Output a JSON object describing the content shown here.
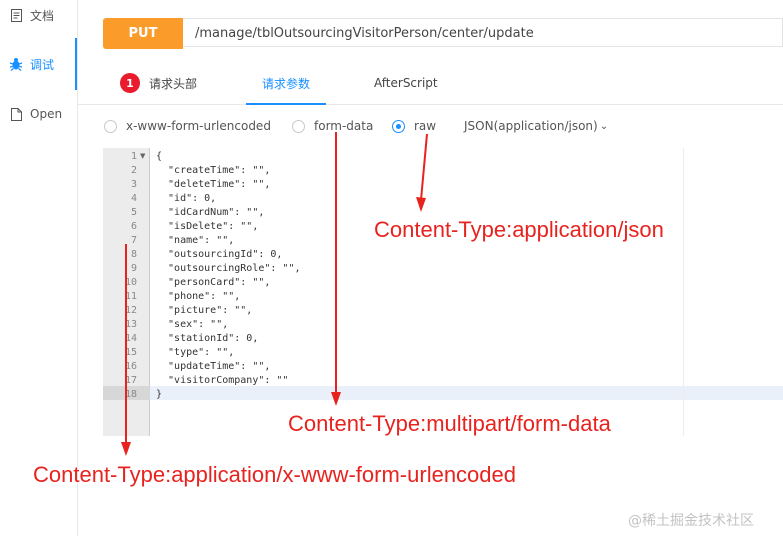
{
  "sidebar": {
    "items": [
      {
        "label": "文档",
        "icon": "document-icon"
      },
      {
        "label": "调试",
        "icon": "bug-icon"
      },
      {
        "label": "Open",
        "icon": "file-icon"
      }
    ]
  },
  "request": {
    "method": "PUT",
    "url": "/manage/tblOutsourcingVisitorPerson/center/update"
  },
  "tabs": [
    {
      "label": "请求头部",
      "badge": "1"
    },
    {
      "label": "请求参数"
    },
    {
      "label": "AfterScript"
    }
  ],
  "body_types": {
    "options": [
      "x-www-form-urlencoded",
      "form-data",
      "raw"
    ],
    "selected": "raw",
    "raw_format": "JSON(application/json)"
  },
  "editor": {
    "line_numbers": [
      "1",
      "2",
      "3",
      "4",
      "5",
      "6",
      "7",
      "8",
      "9",
      "10",
      "11",
      "12",
      "13",
      "14",
      "15",
      "16",
      "17",
      "18"
    ],
    "lines": [
      "{",
      "  \"createTime\": \"\",",
      "  \"deleteTime\": \"\",",
      "  \"id\": 0,",
      "  \"idCardNum\": \"\",",
      "  \"isDelete\": \"\",",
      "  \"name\": \"\",",
      "  \"outsourcingId\": 0,",
      "  \"outsourcingRole\": \"\",",
      "  \"personCard\": \"\",",
      "  \"phone\": \"\",",
      "  \"picture\": \"\",",
      "  \"sex\": \"\",",
      "  \"stationId\": 0,",
      "  \"type\": \"\",",
      "  \"updateTime\": \"\",",
      "  \"visitorCompany\": \"\"",
      "}"
    ]
  },
  "annotations": {
    "json": "Content-Type:application/json",
    "form_data": "Content-Type:multipart/form-data",
    "urlencoded": "Content-Type:application/x-www-form-urlencoded"
  },
  "watermark": "@稀土掘金技术社区",
  "colors": {
    "accent": "#1890ff",
    "method": "#fa9b2a",
    "badge": "#e81c2c",
    "annotation": "#e8231f"
  }
}
